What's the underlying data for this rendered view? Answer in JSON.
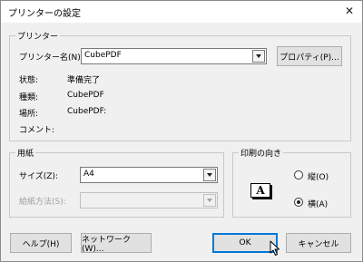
{
  "dialog": {
    "title": "プリンターの設定",
    "close_glyph": "✕"
  },
  "printer": {
    "group_label": "プリンター",
    "name_label": "プリンター名(N):",
    "name_value": "CubePDF",
    "properties_button": "プロパティ(P)...",
    "status_label": "状態:",
    "status_value": "準備完了",
    "type_label": "種類:",
    "type_value": "CubePDF",
    "location_label": "場所:",
    "location_value": "CubePDF:",
    "comment_label": "コメント:",
    "comment_value": ""
  },
  "paper": {
    "group_label": "用紙",
    "size_label": "サイズ(Z):",
    "size_value": "A4",
    "source_label": "給紙方法(S):",
    "source_value": ""
  },
  "orientation": {
    "group_label": "印刷の向き",
    "icon_glyph": "A",
    "portrait_label": "縦(O)",
    "landscape_label": "横(A)",
    "selected": "landscape"
  },
  "buttons": {
    "help": "ヘルプ(H)",
    "network": "ネットワーク(W)...",
    "ok": "OK",
    "cancel": "キャンセル"
  },
  "icons": {
    "close": "close-icon",
    "dropdown": "chevron-down-icon",
    "cursor": "mouse-pointer-icon"
  }
}
